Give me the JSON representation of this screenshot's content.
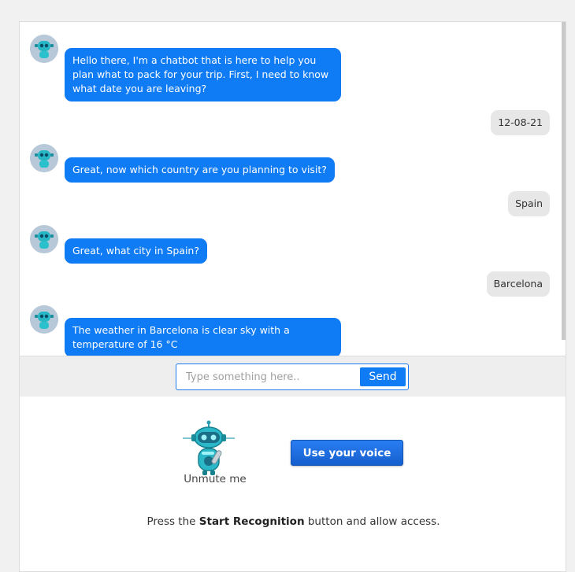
{
  "chat": {
    "messages": [
      {
        "from": "bot",
        "text": "Hello there, I'm a chatbot that is here to help you plan what to pack for your trip. First, I need to know what date you are leaving?"
      },
      {
        "from": "user",
        "text": "12-08-21"
      },
      {
        "from": "bot",
        "text": "Great, now which country are you planning to visit?"
      },
      {
        "from": "user",
        "text": "Spain"
      },
      {
        "from": "bot",
        "text": "Great, what city in Spain?"
      },
      {
        "from": "user",
        "text": "Barcelona"
      },
      {
        "from": "bot",
        "text": "The weather in Barcelona is clear sky with a temperature of 16 °C"
      }
    ]
  },
  "composer": {
    "placeholder": "Type something here..",
    "send_label": "Send"
  },
  "voice": {
    "unmute_label": "Unmute me",
    "button_label": "Use your voice",
    "instructions_prefix": "Press the ",
    "instructions_bold": "Start Recognition",
    "instructions_suffix": " button and allow access."
  },
  "icons": {
    "bot_avatar": "robot-icon",
    "voice_robot": "robot-icon"
  },
  "colors": {
    "bot_bubble": "#0f7bf5",
    "user_bubble": "#e7e7e7",
    "send_button": "#0f7bf5"
  }
}
